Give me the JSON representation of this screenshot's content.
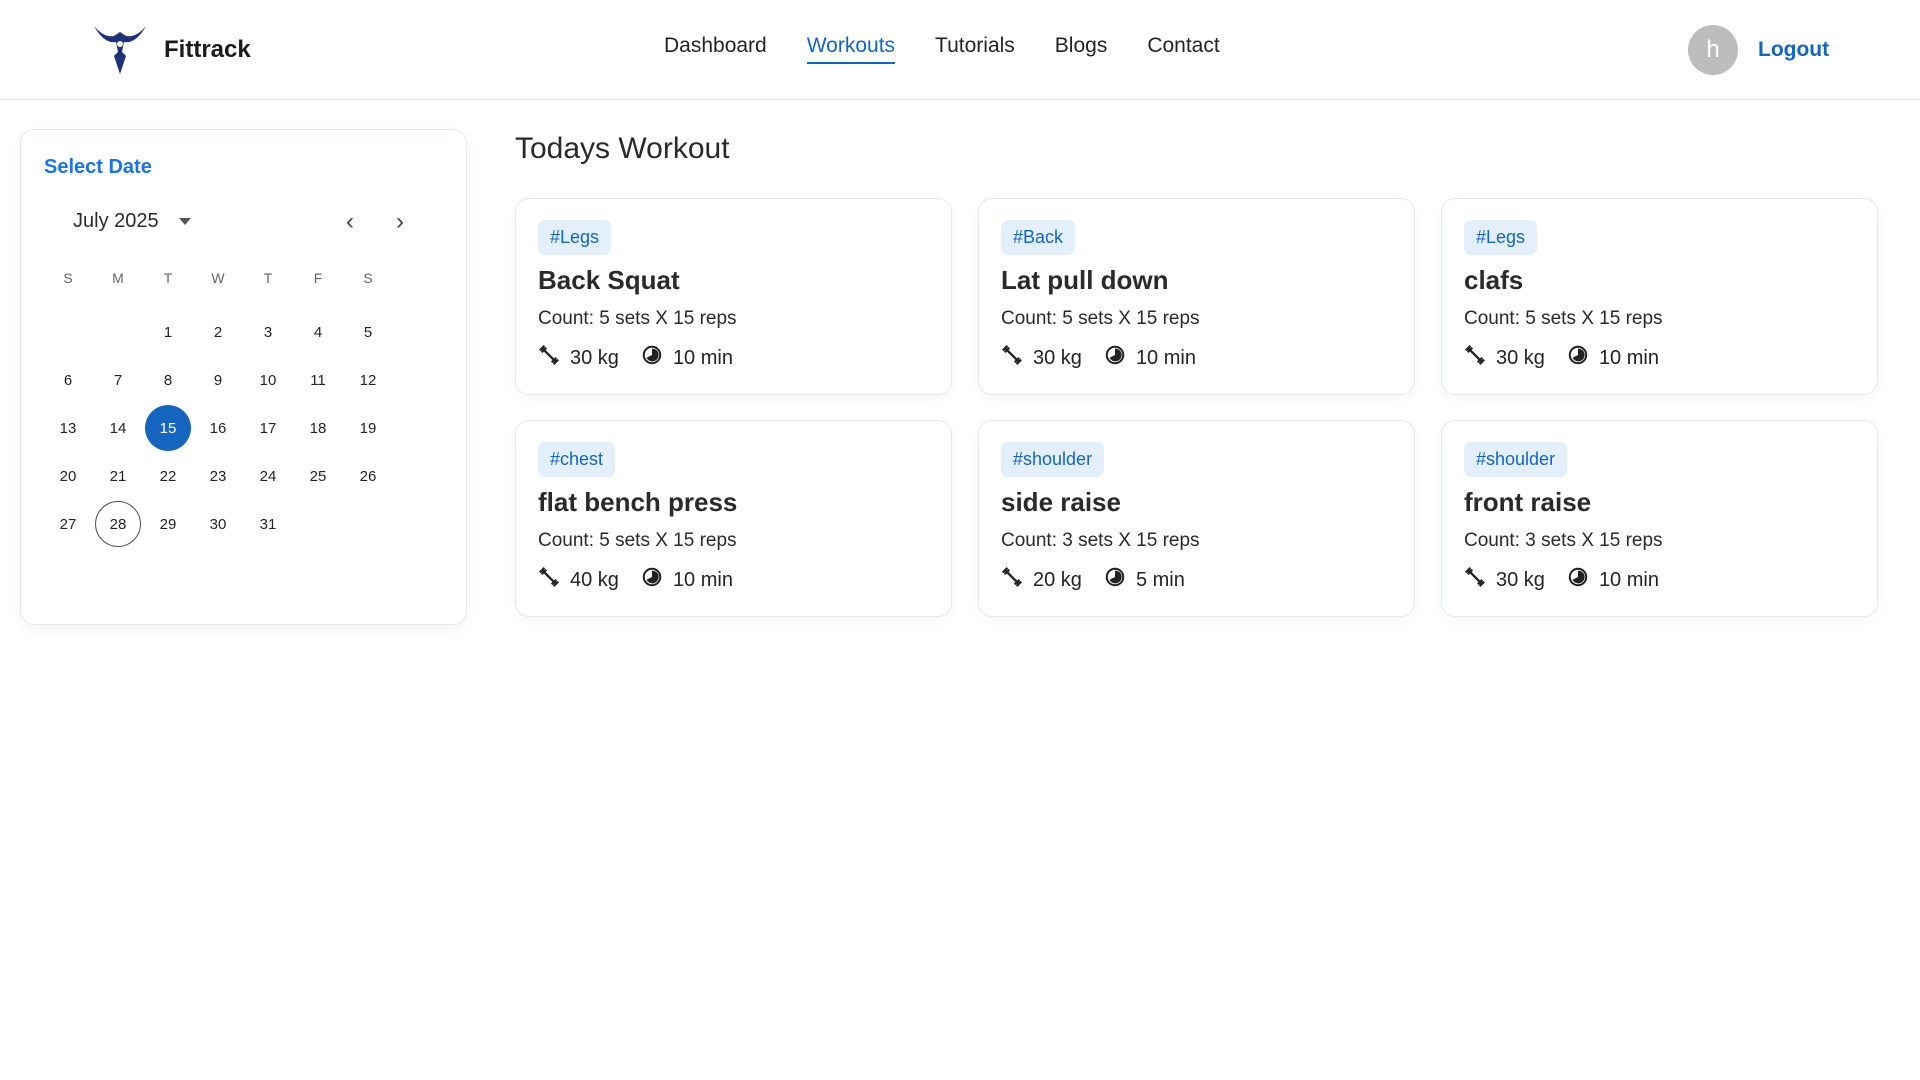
{
  "header": {
    "brand": "Fittrack",
    "nav": [
      "Dashboard",
      "Workouts",
      "Tutorials",
      "Blogs",
      "Contact"
    ],
    "active_nav": "Workouts",
    "avatar_initial": "h",
    "logout": "Logout"
  },
  "calendar": {
    "title": "Select Date",
    "month_label": "July 2025",
    "weekdays": [
      "S",
      "M",
      "T",
      "W",
      "T",
      "F",
      "S"
    ],
    "weeks": [
      [
        "",
        "",
        "1",
        "2",
        "3",
        "4",
        "5"
      ],
      [
        "6",
        "7",
        "8",
        "9",
        "10",
        "11",
        "12"
      ],
      [
        "13",
        "14",
        "15",
        "16",
        "17",
        "18",
        "19"
      ],
      [
        "20",
        "21",
        "22",
        "23",
        "24",
        "25",
        "26"
      ],
      [
        "27",
        "28",
        "29",
        "30",
        "31",
        "",
        ""
      ]
    ],
    "selected_day": "15",
    "today_day": "28",
    "accent": "#1565c0"
  },
  "main": {
    "title": "Todays Workout",
    "workouts": [
      {
        "tag": "#Legs",
        "name": "Back Squat",
        "count": "Count: 5 sets X 15 reps",
        "weight": "30 kg",
        "duration": "10 min"
      },
      {
        "tag": "#Back",
        "name": "Lat pull down",
        "count": "Count: 5 sets X 15 reps",
        "weight": "30 kg",
        "duration": "10 min"
      },
      {
        "tag": "#Legs",
        "name": "clafs",
        "count": "Count: 5 sets X 15 reps",
        "weight": "30 kg",
        "duration": "10 min"
      },
      {
        "tag": "#chest",
        "name": "flat bench press",
        "count": "Count: 5 sets X 15 reps",
        "weight": "40 kg",
        "duration": "10 min"
      },
      {
        "tag": "#shoulder",
        "name": "side raise",
        "count": "Count: 3 sets X 15 reps",
        "weight": "20 kg",
        "duration": "5 min"
      },
      {
        "tag": "#shoulder",
        "name": "front raise",
        "count": "Count: 3 sets X 15 reps",
        "weight": "30 kg",
        "duration": "10 min"
      }
    ],
    "icons": {
      "weight": "weight-icon",
      "duration": "timer-icon"
    }
  }
}
